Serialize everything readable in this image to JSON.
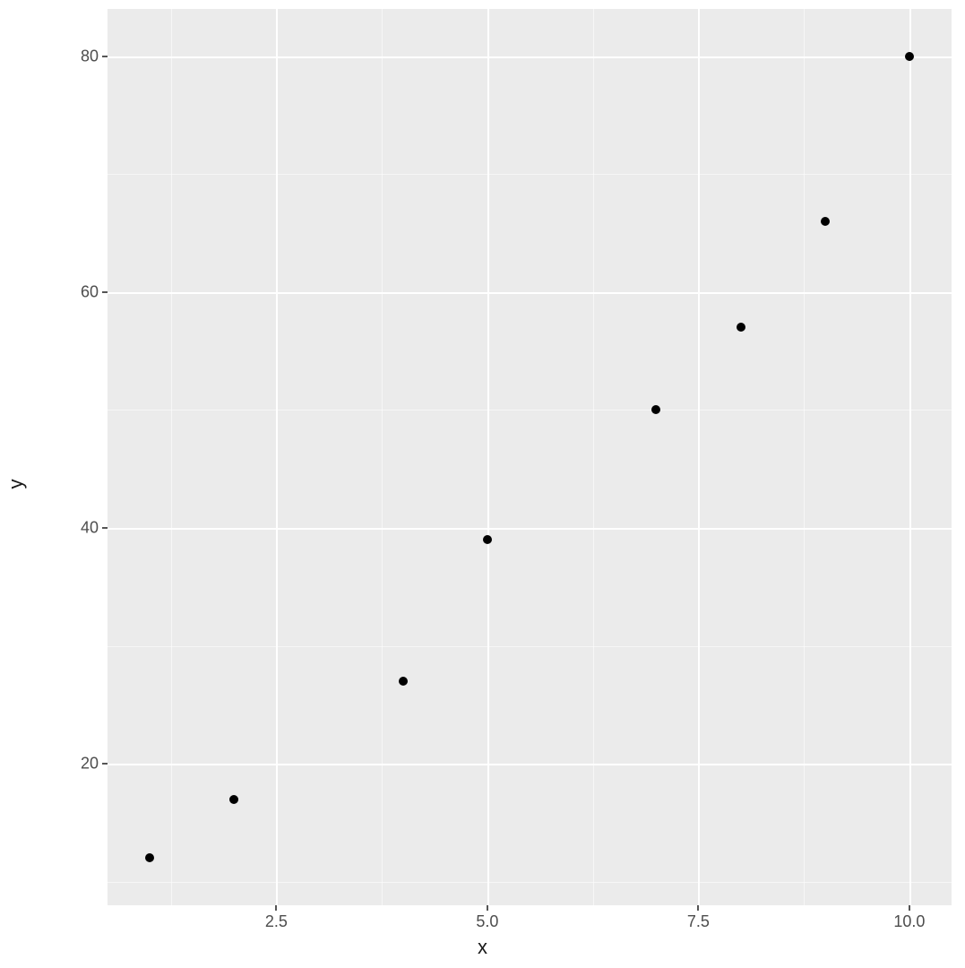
{
  "chart_data": {
    "type": "scatter",
    "title": "",
    "xlabel": "x",
    "ylabel": "y",
    "x": [
      1,
      2,
      4,
      5,
      7,
      8,
      9,
      10
    ],
    "y": [
      12,
      17,
      27,
      39,
      50,
      57,
      66,
      80
    ],
    "xlim": [
      0.5,
      10.5
    ],
    "ylim": [
      8,
      84
    ],
    "x_ticks": [
      2.5,
      5.0,
      7.5,
      10.0
    ],
    "x_tick_labels": [
      "2.5",
      "5.0",
      "7.5",
      "10.0"
    ],
    "y_ticks": [
      20,
      40,
      60,
      80
    ],
    "y_tick_labels": [
      "20",
      "40",
      "60",
      "80"
    ],
    "x_minor_ticks": [
      1.25,
      3.75,
      6.25,
      8.75
    ],
    "y_minor_ticks": [
      10,
      30,
      50,
      70
    ],
    "grid": true,
    "point_color": "#000000",
    "panel_bg": "#ebebeb"
  }
}
